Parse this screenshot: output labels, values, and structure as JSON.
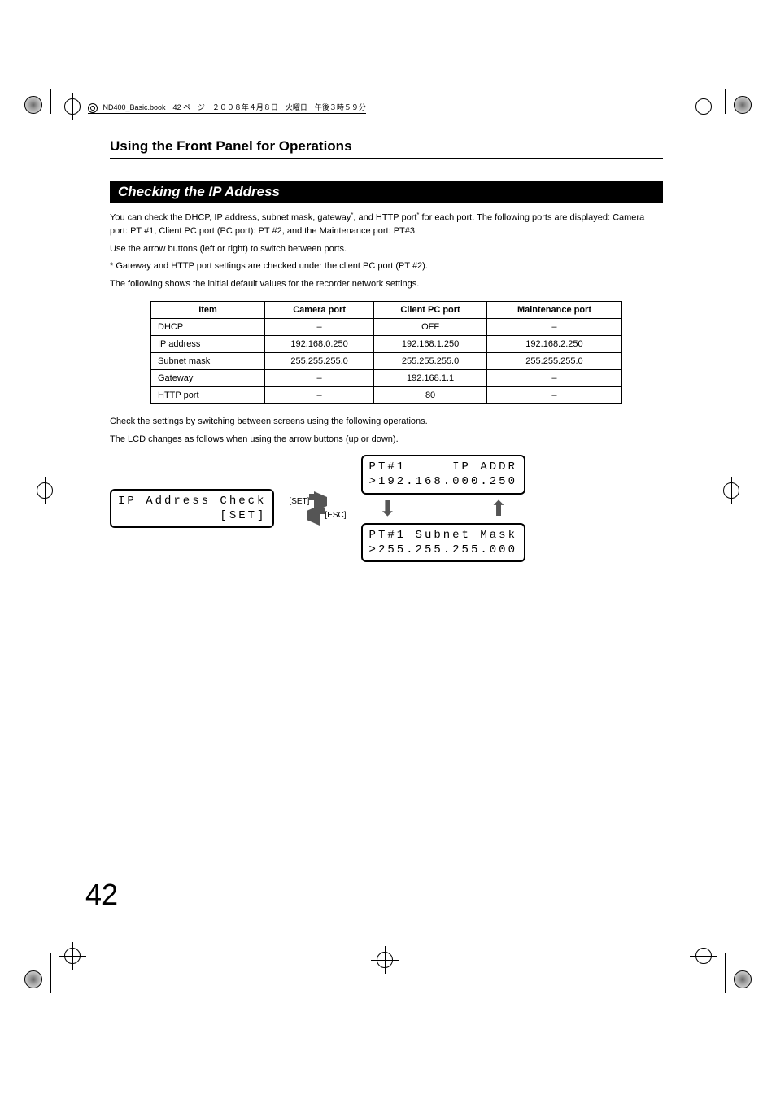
{
  "meta": {
    "header_line": "ND400_Basic.book　42 ページ　２００８年４月８日　火曜日　午後３時５９分"
  },
  "chapter": {
    "title": "Using the Front Panel for Operations"
  },
  "section": {
    "title": "Checking the IP Address"
  },
  "para1a": "You can check the DHCP, IP address, subnet mask, gateway",
  "para1b": ", and HTTP port",
  "para1c": " for each port. The following ports are displayed: Camera port: PT #1, Client PC port (PC port): PT #2, and the Maintenance port: PT#3.",
  "para2": "Use the arrow buttons (left or right) to switch between ports.",
  "para3": "*  Gateway and HTTP port settings are checked under the client PC port (PT #2).",
  "para4": "The following shows the initial default values for the recorder network settings.",
  "table": {
    "headers": [
      "Item",
      "Camera port",
      "Client PC port",
      "Maintenance port"
    ],
    "rows": [
      [
        "DHCP",
        "–",
        "OFF",
        "–"
      ],
      [
        "IP address",
        "192.168.0.250",
        "192.168.1.250",
        "192.168.2.250"
      ],
      [
        "Subnet mask",
        "255.255.255.0",
        "255.255.255.0",
        "255.255.255.0"
      ],
      [
        "Gateway",
        "–",
        "192.168.1.1",
        "–"
      ],
      [
        "HTTP port",
        "–",
        "80",
        "–"
      ]
    ]
  },
  "para5": "Check the settings by switching between screens using the following operations.",
  "para6": "The LCD changes as follows when using the arrow buttons (up or down).",
  "lcd1_line1": "IP Address Check",
  "lcd1_line2": "           [SET]",
  "label_set": "[SET]",
  "label_esc": "[ESC]",
  "lcd2_line1": "PT#1     IP ADDR",
  "lcd2_line2": ">192.168.000.250",
  "lcd3_line1": "PT#1 Subnet Mask",
  "lcd3_line2": ">255.255.255.000",
  "page_number": "42"
}
